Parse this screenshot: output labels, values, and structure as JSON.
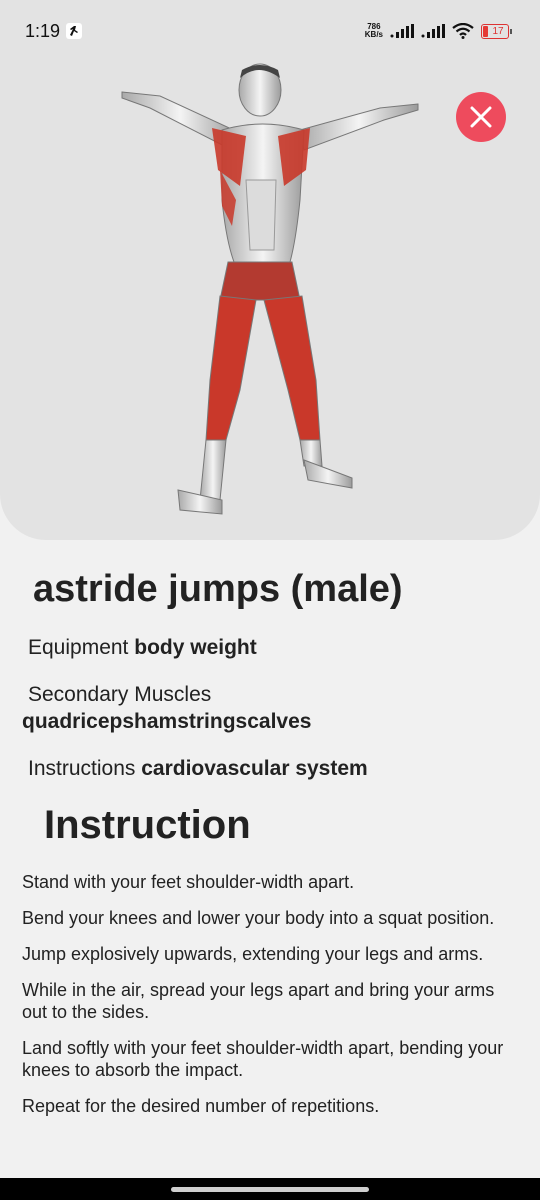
{
  "status": {
    "time": "1:19",
    "net_speed_value": "786",
    "net_speed_unit": "KB/s",
    "battery": "17"
  },
  "exercise": {
    "title": "astride jumps (male)",
    "equipment_label": "Equipment",
    "equipment_value": "body weight",
    "secondary_label": "Secondary Muscles",
    "secondary_value": "quadricepshamstringscalves",
    "instructions_label": "Instructions",
    "instructions_value": "cardiovascular system"
  },
  "instruction_section": {
    "heading": "Instruction",
    "steps": [
      "Stand with your feet shoulder-width apart.",
      "Bend your knees and lower your body into a squat position.",
      "Jump explosively upwards, extending your legs and arms.",
      "While in the air, spread your legs apart and bring your arms out to the sides.",
      "Land softly with your feet shoulder-width apart, bending your knees to absorb the impact.",
      "Repeat for the desired number of repetitions."
    ]
  },
  "colors": {
    "close_button": "#ee4b5d",
    "muscle_highlight": "#c9382a",
    "hero_background": "#e3e3e3",
    "page_background": "#f1f1f1"
  },
  "icons": [
    "runner-icon",
    "signal-icon",
    "wifi-icon",
    "battery-icon",
    "close-icon"
  ]
}
